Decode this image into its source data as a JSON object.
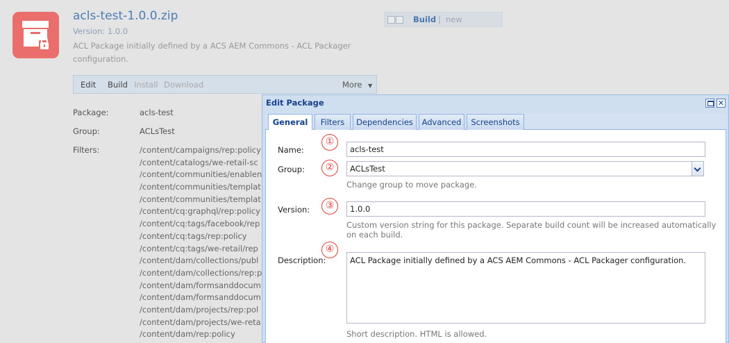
{
  "package": {
    "icon": "package-lock-icon",
    "icon_color": "#ea6e6c",
    "name": "acls-test-1.0.0.zip",
    "version_line": "Version: 1.0.0",
    "description": "ACL Package initially defined by a ACS AEM Commons - ACL Packager configuration.",
    "status": {
      "build": "Build",
      "separator": "|",
      "state": "new"
    },
    "toolbar": {
      "edit": "Edit",
      "build": "Build",
      "install": "Install",
      "download": "Download",
      "more": "More"
    },
    "info": {
      "package_label": "Package:",
      "package_value": "acls-test",
      "group_label": "Group:",
      "group_value": "ACLsTest",
      "filters_label": "Filters:",
      "filters": [
        "/content/campaigns/rep:policy",
        "/content/catalogs/we-retail-sc",
        "/content/communities/enablen",
        "/content/communities/templat",
        "/content/communities/templat",
        "/content/cq:graphql/rep:policy",
        "/content/cq:tags/facebook/rep",
        "/content/cq:tags/rep:policy",
        "/content/cq:tags/we-retail/rep",
        "/content/dam/collections/publ",
        "/content/dam/collections/rep:p",
        "/content/dam/formsanddocum",
        "/content/dam/formsanddocum",
        "/content/dam/projects/rep:pol",
        "/content/dam/projects/we-reta",
        "/content/dam/rep:policy"
      ]
    }
  },
  "dialog": {
    "title": "Edit Package",
    "tabs": [
      "General",
      "Filters",
      "Dependencies",
      "Advanced",
      "Screenshots"
    ],
    "active_tab": "General",
    "fields": {
      "name_label": "Name:",
      "name_value": "acls-test",
      "group_label": "Group:",
      "group_value": "ACLsTest",
      "group_help": "Change group to move package.",
      "version_label": "Version:",
      "version_value": "1.0.0",
      "version_help_1": "Custom version string for this package. Separate build count will be increased automatically",
      "version_help_2": "on each build.",
      "description_label": "Description:",
      "description_value": "ACL Package initially defined by a ACS AEM Commons - ACL Packager configuration.",
      "description_help": "Short description. HTML is allowed."
    },
    "markers": [
      "①",
      "②",
      "③",
      "④"
    ],
    "marker_color": "#e03a3a"
  }
}
